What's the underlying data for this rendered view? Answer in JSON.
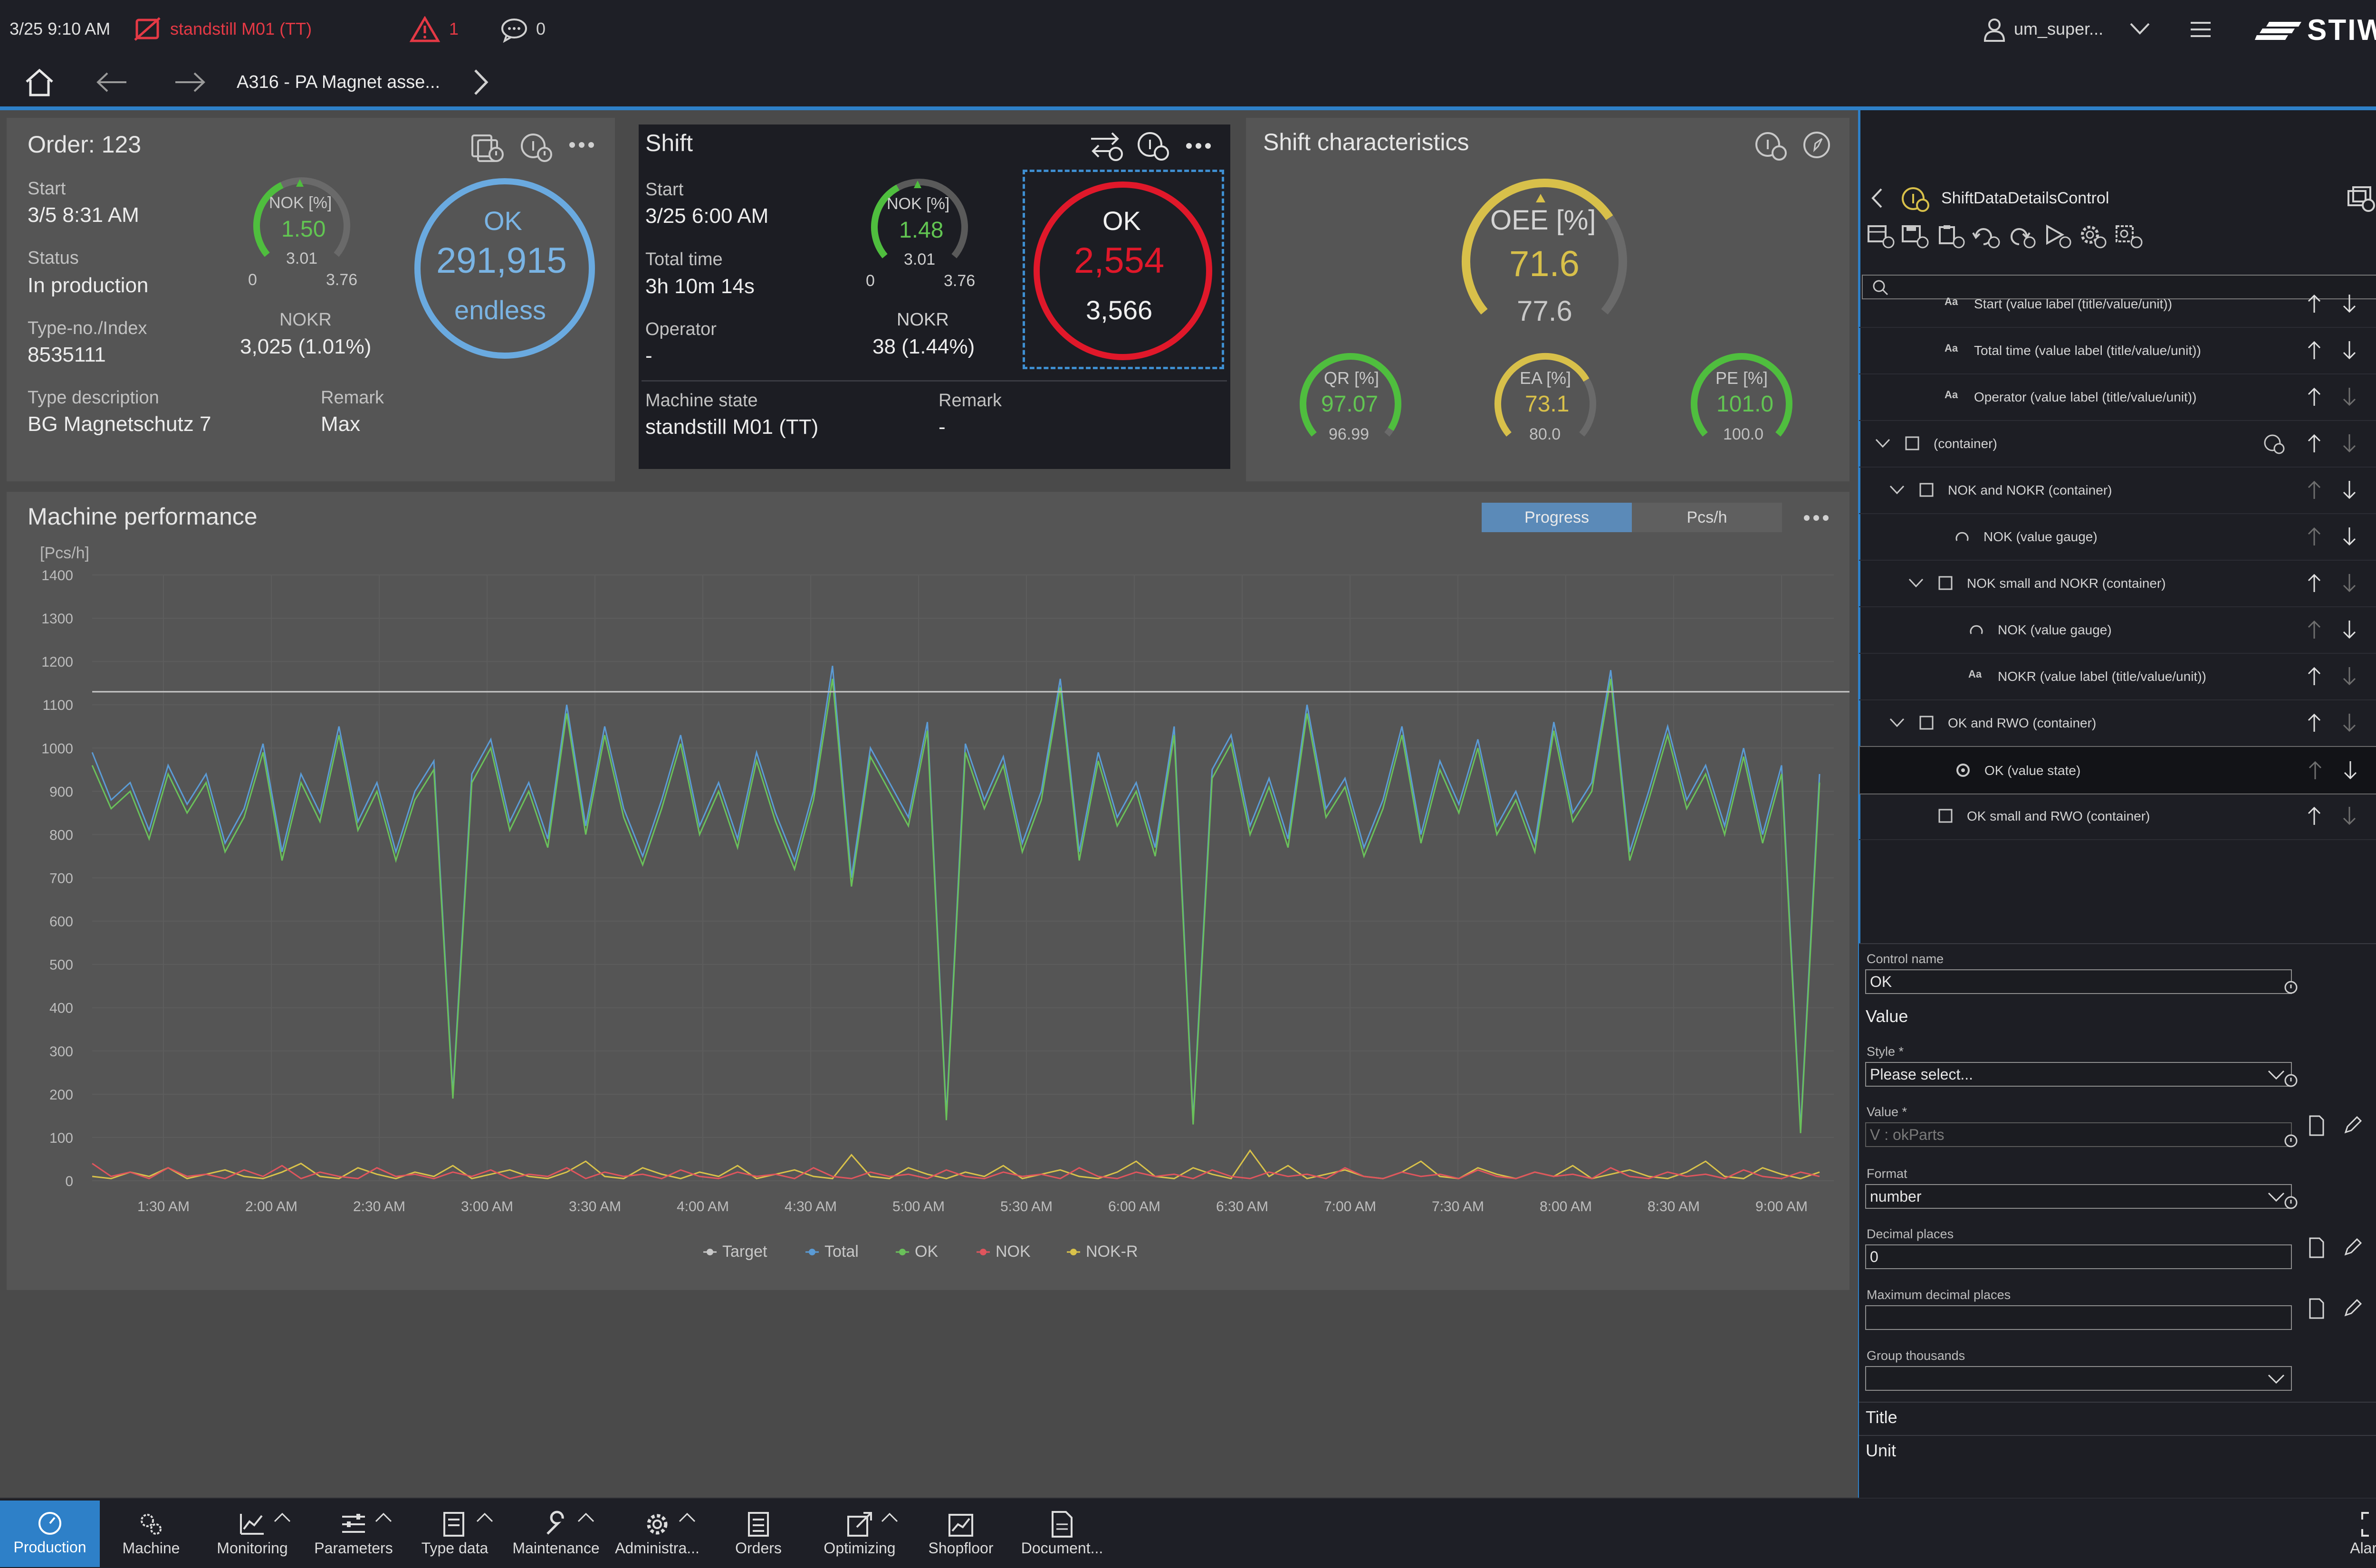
{
  "topbar": {
    "datetime": "3/25 9:10 AM",
    "machine_state": "standstill M01 (TT)",
    "alarm_count": "1",
    "message_count": "0",
    "user": "um_super...",
    "logo": "STIWA"
  },
  "navbar": {
    "breadcrumb": "A316 - PA Magnet asse..."
  },
  "order_card": {
    "title": "Order: 123",
    "start_label": "Start",
    "start_value": "3/5 8:31 AM",
    "status_label": "Status",
    "status_value": "In production",
    "type_label": "Type-no./Index",
    "type_value": "8535111",
    "typedesc_label": "Type description",
    "typedesc_value": "BG Magnetschutz 7",
    "remark_label": "Remark",
    "remark_value": "Max",
    "nok_gauge": {
      "label": "NOK [%]",
      "value": "1.50",
      "mid": "3.01",
      "min": "0",
      "max": "3.76",
      "fraction": 0.4
    },
    "nokr_label": "NOKR",
    "nokr_value": "3,025 (1.01%)",
    "ok_label": "OK",
    "ok_value": "291,915",
    "ok_sub": "endless"
  },
  "shift_card": {
    "title": "Shift",
    "start_label": "Start",
    "start_value": "3/25 6:00 AM",
    "total_label": "Total time",
    "total_value": "3h 10m 14s",
    "operator_label": "Operator",
    "operator_value": "-",
    "machine_state_label": "Machine state",
    "machine_state_value": "standstill M01 (TT)",
    "remark_label": "Remark",
    "remark_value": "-",
    "nok_gauge": {
      "label": "NOK [%]",
      "value": "1.48",
      "mid": "3.01",
      "min": "0",
      "max": "3.76",
      "fraction": 0.39
    },
    "nokr_label": "NOKR",
    "nokr_value": "38 (1.44%)",
    "ok_label": "OK",
    "ok_value": "2,554",
    "ok_sub": "3,566"
  },
  "shift_char_card": {
    "title": "Shift characteristics",
    "oee": {
      "label": "OEE [%]",
      "value": "71.6",
      "sub": "77.6",
      "fraction": 0.716
    },
    "qr": {
      "label": "QR [%]",
      "value": "97.07",
      "sub": "96.99",
      "fraction": 0.97
    },
    "ea": {
      "label": "EA [%]",
      "value": "73.1",
      "sub": "80.0",
      "fraction": 0.73
    },
    "pe": {
      "label": "PE [%]",
      "value": "101.0",
      "sub": "100.0",
      "fraction": 1.0
    }
  },
  "performance": {
    "title": "Machine performance",
    "tab_progress": "Progress",
    "tab_pcsh": "Pcs/h"
  },
  "chart_data": {
    "type": "line",
    "ylabel": "[Pcs/h]",
    "ylim": [
      0,
      1400
    ],
    "yticks": [
      0,
      100,
      200,
      300,
      400,
      500,
      600,
      700,
      800,
      900,
      1000,
      1100,
      1200,
      1300,
      1400
    ],
    "xticks": [
      "1:30 AM",
      "2:00 AM",
      "2:30 AM",
      "3:00 AM",
      "3:30 AM",
      "4:00 AM",
      "4:30 AM",
      "5:00 AM",
      "5:30 AM",
      "6:00 AM",
      "6:30 AM",
      "7:00 AM",
      "7:30 AM",
      "8:00 AM",
      "8:30 AM",
      "9:00 AM"
    ],
    "x_start_minutes": 70,
    "x_step_minutes": 5,
    "legend": [
      "Target",
      "Total",
      "OK",
      "NOK",
      "NOK-R"
    ],
    "legend_position": "bottom-center",
    "colors": {
      "Target": "#c8c8c8",
      "Total": "#5b9bd5",
      "OK": "#6ac15a",
      "NOK": "#e0555d",
      "NOK-R": "#d9c24a"
    },
    "series": [
      {
        "name": "Target",
        "values": [
          1130,
          1130,
          1130,
          1130,
          1130,
          1130,
          1130,
          1130,
          1130,
          1130,
          1130,
          1130,
          1130,
          1130,
          1130,
          1130,
          1130,
          1130,
          1130,
          1130,
          1130,
          1130,
          1130,
          1130,
          1130,
          1130,
          1130,
          1130,
          1130,
          1130,
          1130,
          1130,
          1130,
          1130,
          1130,
          1130,
          1130,
          1130,
          1130,
          1130,
          1130,
          1130,
          1130,
          1130,
          1130,
          1130,
          1130,
          1130,
          1130,
          1130,
          1130,
          1130,
          1130,
          1130,
          1130,
          1130,
          1130,
          1130,
          1130,
          1130,
          1130,
          1130,
          1130,
          1130,
          1130,
          1130,
          1130,
          1130,
          1130,
          1130,
          1130,
          1130,
          1130,
          1130,
          1130,
          1130,
          1130,
          1130,
          1130,
          1130,
          1130,
          1130,
          1130,
          1130,
          1130,
          1130,
          1130,
          1130,
          1130,
          1130,
          1130,
          1130,
          1130,
          1130,
          1130,
          1130,
          1130,
          1130,
          1130,
          1130
        ]
      },
      {
        "name": "Total",
        "values": [
          990,
          880,
          920,
          810,
          960,
          870,
          940,
          780,
          860,
          1010,
          760,
          940,
          850,
          1050,
          830,
          920,
          760,
          900,
          970,
          200,
          940,
          1020,
          830,
          920,
          790,
          1100,
          820,
          1050,
          860,
          750,
          880,
          1030,
          820,
          920,
          790,
          990,
          850,
          740,
          900,
          1190,
          700,
          1000,
          920,
          840,
          1060,
          150,
          1010,
          880,
          980,
          780,
          900,
          1160,
          760,
          990,
          840,
          920,
          770,
          1050,
          140,
          950,
          1030,
          820,
          930,
          790,
          1100,
          860,
          930,
          770,
          880,
          1050,
          800,
          970,
          870,
          1020,
          820,
          900,
          780,
          1060,
          850,
          920,
          1180,
          760,
          900,
          1050,
          880,
          960,
          820,
          1000,
          800,
          960,
          120,
          940
        ]
      },
      {
        "name": "OK",
        "values": [
          960,
          860,
          900,
          790,
          940,
          850,
          920,
          760,
          840,
          990,
          740,
          920,
          830,
          1030,
          810,
          900,
          740,
          880,
          950,
          190,
          920,
          1000,
          810,
          900,
          770,
          1080,
          800,
          1030,
          840,
          730,
          860,
          1010,
          800,
          900,
          770,
          970,
          830,
          720,
          880,
          1160,
          680,
          980,
          900,
          820,
          1040,
          140,
          990,
          860,
          960,
          760,
          880,
          1140,
          740,
          970,
          820,
          900,
          750,
          1030,
          130,
          930,
          1010,
          800,
          910,
          770,
          1080,
          840,
          910,
          750,
          860,
          1030,
          780,
          950,
          850,
          1000,
          800,
          880,
          760,
          1040,
          830,
          900,
          1160,
          740,
          880,
          1030,
          860,
          940,
          800,
          980,
          780,
          940,
          110,
          920
        ]
      },
      {
        "name": "NOK",
        "values": [
          40,
          10,
          20,
          5,
          30,
          10,
          15,
          5,
          25,
          10,
          35,
          5,
          20,
          10,
          5,
          30,
          10,
          15,
          5,
          20,
          10,
          25,
          5,
          15,
          10,
          30,
          5,
          20,
          10,
          15,
          5,
          25,
          10,
          5,
          20,
          10,
          15,
          5,
          30,
          10,
          5,
          20,
          10,
          15,
          5,
          25,
          10,
          5,
          20,
          10,
          15,
          5,
          30,
          10,
          5,
          20,
          10,
          15,
          5,
          25,
          10,
          5,
          20,
          10,
          15,
          5,
          30,
          10,
          5,
          20,
          10,
          15,
          5,
          25,
          10,
          5,
          20,
          10,
          15,
          5,
          30,
          10,
          5,
          20,
          10,
          15,
          5,
          25,
          10,
          5,
          20,
          10
        ]
      },
      {
        "name": "NOK-R",
        "values": [
          10,
          5,
          20,
          10,
          30,
          5,
          15,
          25,
          10,
          5,
          20,
          40,
          10,
          5,
          30,
          15,
          5,
          20,
          10,
          35,
          5,
          15,
          25,
          10,
          5,
          20,
          45,
          10,
          5,
          30,
          15,
          5,
          20,
          10,
          35,
          5,
          15,
          25,
          10,
          5,
          60,
          10,
          5,
          30,
          15,
          5,
          20,
          10,
          35,
          5,
          15,
          25,
          10,
          5,
          20,
          45,
          10,
          5,
          30,
          15,
          5,
          70,
          10,
          35,
          5,
          15,
          25,
          10,
          5,
          20,
          45,
          10,
          5,
          30,
          15,
          5,
          20,
          10,
          35,
          5,
          15,
          25,
          10,
          5,
          20,
          45,
          10,
          5,
          30,
          15,
          5,
          20
        ]
      }
    ]
  },
  "right_panel": {
    "title": "ShiftDataDetailsControl",
    "search_placeholder": "",
    "tree": [
      {
        "label": "Start (value label (title/value/unit))",
        "icon": "Aa"
      },
      {
        "label": "Total time (value label (title/value/unit))",
        "icon": "Aa"
      },
      {
        "label": "Operator (value label (title/value/unit))",
        "icon": "Aa"
      },
      {
        "label": "(container)",
        "icon": "box"
      },
      {
        "label": "NOK and NOKR (container)",
        "icon": "box"
      },
      {
        "label": "NOK (value gauge)",
        "icon": "gauge"
      },
      {
        "label": "NOK small and NOKR (container)",
        "icon": "box"
      },
      {
        "label": "NOK (value gauge)",
        "icon": "gauge"
      },
      {
        "label": "NOKR (value label (title/value/unit))",
        "icon": "Aa"
      },
      {
        "label": "OK and RWO (container)",
        "icon": "box"
      },
      {
        "label": "OK (value state)",
        "icon": "state"
      },
      {
        "label": "OK small and RWO (container)",
        "icon": "box"
      }
    ],
    "control_name_label": "Control name",
    "control_name_value": "OK",
    "value_section": "Value",
    "style_label": "Style *",
    "style_value": "Please select...",
    "value_label": "Value *",
    "value_value": "V : okParts",
    "format_label": "Format",
    "format_value": "number",
    "decimal_label": "Decimal places",
    "decimal_value": "0",
    "maxdec_label": "Maximum decimal places",
    "maxdec_value": "",
    "group_label": "Group thousands",
    "group_value": "",
    "title_section": "Title",
    "unit_section": "Unit"
  },
  "bottom_nav": {
    "items": [
      "Production",
      "Machine",
      "Monitoring",
      "Parameters",
      "Type data",
      "Maintenance",
      "Administra...",
      "Orders",
      "Optimizing",
      "Shopfloor",
      "Document..."
    ],
    "alarms": "Alarms"
  }
}
